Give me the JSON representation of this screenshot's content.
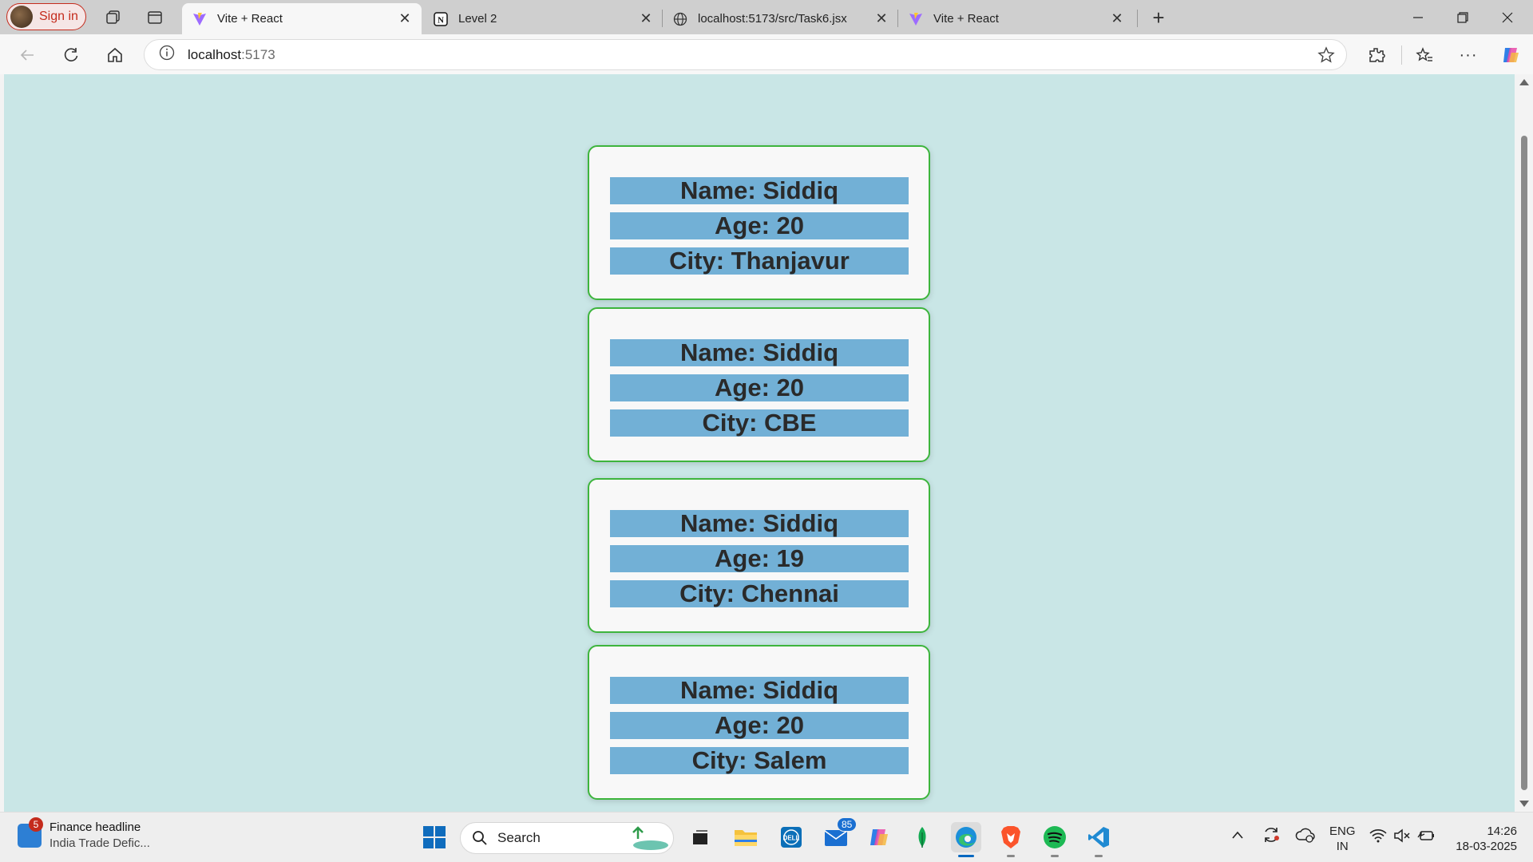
{
  "browser": {
    "profile_label": "Sign in",
    "tabs": [
      {
        "title": "Vite + React",
        "active": true,
        "favicon": "vite-icon"
      },
      {
        "title": "Level 2",
        "active": false,
        "favicon": "notion-icon"
      },
      {
        "title": "localhost:5173/src/Task6.jsx",
        "active": false,
        "favicon": "globe-icon"
      },
      {
        "title": "Vite + React",
        "active": false,
        "favicon": "vite-icon"
      }
    ],
    "address": {
      "host": "localhost",
      "port": ":5173"
    }
  },
  "cards": [
    {
      "name": "Name: Siddiq",
      "age": "Age: 20",
      "city": "City: Thanjavur"
    },
    {
      "name": "Name: Siddiq",
      "age": "Age: 20",
      "city": "City: CBE"
    },
    {
      "name": "Name: Siddiq",
      "age": "Age: 19",
      "city": "City: Chennai"
    },
    {
      "name": "Name: Siddiq",
      "age": "Age: 20",
      "city": "City: Salem"
    }
  ],
  "taskbar": {
    "news_badge": "5",
    "news_title": "Finance headline",
    "news_subtitle": "India Trade Defic...",
    "search_label": "Search",
    "mail_badge": "85",
    "lang_line1": "ENG",
    "lang_line2": "IN",
    "time": "14:26",
    "date": "18-03-2025"
  },
  "colors": {
    "page_bg": "#c9e6e6",
    "card_border": "#3db53d",
    "field_bg": "#72b0d6"
  }
}
